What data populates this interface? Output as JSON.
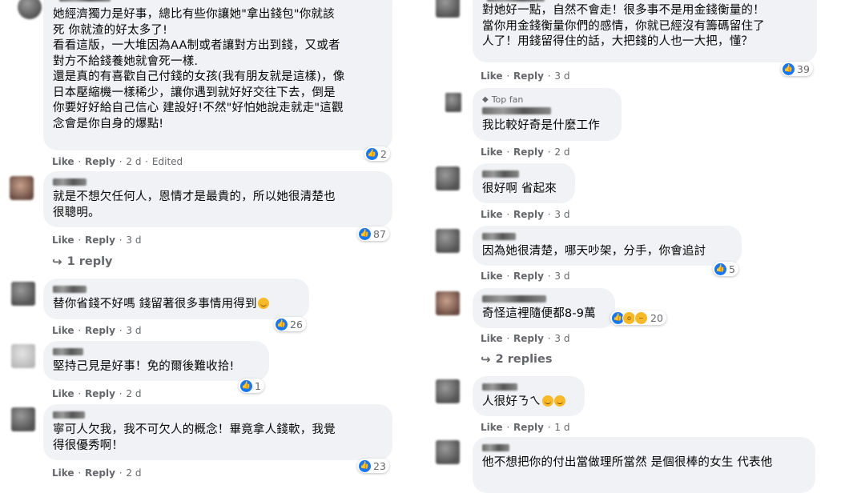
{
  "left": [
    {
      "text": "她經濟獨力是好事，總比有些你讓她\"拿出錢包\"你就該\n死 你就渣的好太多了!\n看看這版，一大堆因為AA制或者讓對方出到錢，又或者\n對方不給錢養她就會死一樣.\n還是真的有喜歡自己付錢的女孩(我有朋友就是這樣)，像\n日本壓縮機一樣稀少，讓你遇到就好好交往下去，倒是\n你要好好給自己信心 建設好!不然\"好怕她說走就走\"這觀\n念會是你自身的爆點!",
      "reactions": "2",
      "like": "Like",
      "reply": "Reply",
      "time": "2 d",
      "edited": "Edited"
    },
    {
      "text": "就是不想欠任何人，恩情才是最貴的，所以她很清楚也\n很聰明。",
      "reactions": "87",
      "like": "Like",
      "reply": "Reply",
      "time": "3 d",
      "replies_label": "1 reply"
    },
    {
      "text": "替你省錢不好嗎 錢留著很多事情用得到",
      "reactions": "26",
      "like": "Like",
      "reply": "Reply",
      "time": "3 d"
    },
    {
      "text": "堅持己見是好事！免的爾後難收拾!",
      "reactions": "1",
      "like": "Like",
      "reply": "Reply",
      "time": "2 d"
    },
    {
      "text": "寧可人欠我，我不可欠人的概念！畢竟拿人錢軟，我覺\n得很優秀啊！",
      "reactions": "23",
      "like": "Like",
      "reply": "Reply",
      "time": "2 d"
    }
  ],
  "right": [
    {
      "text": "對她好一點，自然不會走！很多事不是用金錢衡量的！\n當你用金錢衡量你們的感情，你就已經沒有籌碼留住了\n人了！用錢留得住的話，大把錢的人也一大把，懂？",
      "reactions": "39",
      "like": "Like",
      "reply": "Reply",
      "time": "3 d"
    },
    {
      "badge": "Top fan",
      "text": "我比較好奇是什麼工作",
      "like": "Like",
      "reply": "Reply",
      "time": "2 d"
    },
    {
      "text": "很好啊 省起來",
      "like": "Like",
      "reply": "Reply",
      "time": "3 d"
    },
    {
      "text": "因為她很清楚，哪天吵架，分手，你會追討",
      "reactions": "5",
      "like": "Like",
      "reply": "Reply",
      "time": "3 d"
    },
    {
      "text": "奇怪這裡隨便都8-9萬",
      "reactions": "20",
      "like": "Like",
      "reply": "Reply",
      "time": "3 d",
      "replies_label": "2 replies"
    },
    {
      "text": "人很好ㄋㄟ",
      "like": "Like",
      "reply": "Reply",
      "time": "1 d"
    },
    {
      "text": "他不想把你的付出當做理所當然 是個很棒的女生 代表他"
    }
  ],
  "icons": {
    "like": "thumbs-up-icon",
    "reply_arrow": "reply-arrow-icon",
    "top_fan": "diamond-icon"
  },
  "colors": {
    "bubble": "#f0f2f5",
    "like_blue": "#1877f2",
    "meta_gray": "#65676b",
    "emoji_yellow": "#f7b928"
  }
}
